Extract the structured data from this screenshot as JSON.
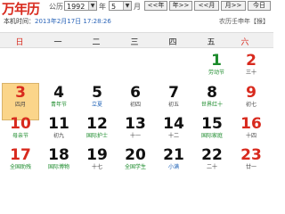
{
  "header": {
    "logo": "万年历",
    "calendar_type_label": "公历",
    "year": "1992",
    "year_unit": "年",
    "month": "5",
    "month_unit": "月",
    "buttons": {
      "prev_year": "<<年",
      "next_year": "年>>",
      "prev_month": "<<月",
      "next_month": "月>>",
      "today": "今日"
    }
  },
  "time_row": {
    "label": "本机时间：",
    "value": "2013年2月17日 17:28:26"
  },
  "lunar_info": "农历壬申年【猴】",
  "weekdays": [
    "日",
    "一",
    "二",
    "三",
    "四",
    "五",
    "六"
  ],
  "days": [
    {
      "num": "1",
      "sub": "劳动节"
    },
    {
      "num": "2",
      "sub": "三十"
    },
    {
      "num": "3",
      "sub": "四月"
    },
    {
      "num": "4",
      "sub": "青年节"
    },
    {
      "num": "5",
      "sub": "立夏"
    },
    {
      "num": "6",
      "sub": "初四"
    },
    {
      "num": "7",
      "sub": "初五"
    },
    {
      "num": "8",
      "sub": "世界红十"
    },
    {
      "num": "9",
      "sub": "初七"
    },
    {
      "num": "10",
      "sub": "母亲节"
    },
    {
      "num": "11",
      "sub": "初九"
    },
    {
      "num": "12",
      "sub": "国际护士"
    },
    {
      "num": "13",
      "sub": "十一"
    },
    {
      "num": "14",
      "sub": "十二"
    },
    {
      "num": "15",
      "sub": "国际家庭"
    },
    {
      "num": "16",
      "sub": "十四"
    },
    {
      "num": "17",
      "sub": "全国助残"
    },
    {
      "num": "18",
      "sub": "国际博物"
    },
    {
      "num": "19",
      "sub": "十七"
    },
    {
      "num": "20",
      "sub": "全国学生"
    },
    {
      "num": "21",
      "sub": "小满"
    },
    {
      "num": "22",
      "sub": "二十"
    },
    {
      "num": "23",
      "sub": "廿一"
    }
  ]
}
